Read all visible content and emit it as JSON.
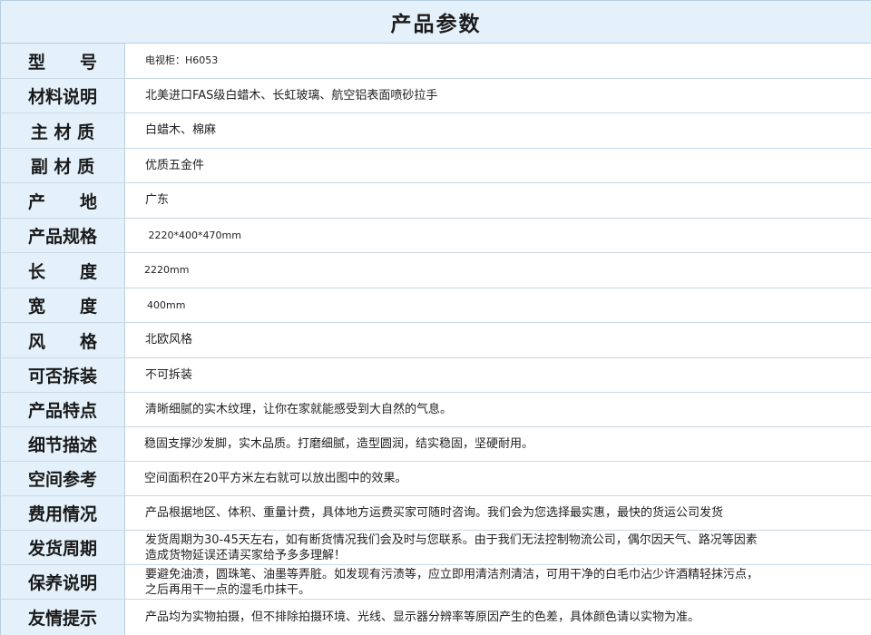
{
  "title": "产品参数",
  "rows": [
    {
      "label": "型　　号",
      "value": "电视柜：H6053"
    },
    {
      "label": "材料说明",
      "value": "北美进口FAS级白蜡木、长虹玻璃、航空铝表面喷砂拉手"
    },
    {
      "label": "主 材 质",
      "value": "白蜡木、棉麻"
    },
    {
      "label": "副 材 质",
      "value": "优质五金件"
    },
    {
      "label": "产　　地",
      "value": "广东"
    },
    {
      "label": "产品规格",
      "value": " 2220*400*470mm"
    },
    {
      "label": "长　　度",
      "value": "2220mm"
    },
    {
      "label": "宽　　度",
      "value": "400mm"
    },
    {
      "label": "风　　格",
      "value": "北欧风格"
    },
    {
      "label": "可否拆装",
      "value": "不可拆装"
    },
    {
      "label": "产品特点",
      "value": "清晰细腻的实木纹理，让你在家就能感受到大自然的气息。"
    },
    {
      "label": "细节描述",
      "value": "稳固支撑沙发脚，实木品质。打磨细腻，造型圆润，结实稳固，坚硬耐用。"
    },
    {
      "label": "空间参考",
      "value": "空间面积在20平方米左右就可以放出图中的效果。"
    },
    {
      "label": "费用情况",
      "value": "产品根据地区、体积、重量计费，具体地方运费买家可随时咨询。我们会为您选择最实惠，最快的货运公司发货"
    },
    {
      "label": "发货周期",
      "value": "发货周期为30-45天左右，如有断货情况我们会及时与您联系。由于我们无法控制物流公司，偶尔因天气、路况等因素\n造成货物延误还请买家给予多多理解！"
    },
    {
      "label": "保养说明",
      "value": "要避免油渍，圆珠笔、油墨等弄脏。如发现有污渍等，应立即用清洁剂清洁，可用干净的白毛巾沾少许酒精轻抹污点，\n之后再用干一点的湿毛巾抹干。"
    },
    {
      "label": "友情提示",
      "value": "产品均为实物拍摄，但不排除拍摄环境、光线、显示器分辨率等原因产生的色差，具体颜色请以实物为准。"
    }
  ]
}
